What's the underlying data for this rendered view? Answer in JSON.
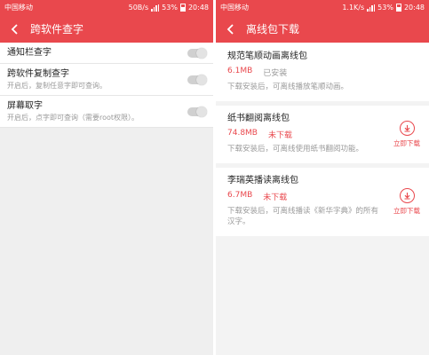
{
  "theme": {
    "accent": "#e9484d"
  },
  "left": {
    "status": {
      "carrier": "中国移动",
      "speed": "50B/s",
      "battery": "53%",
      "time": "20:48"
    },
    "title": "跨软件查字",
    "settings": [
      {
        "title": "通知栏查字",
        "subtitle": "",
        "enabled": false
      },
      {
        "title": "跨软件复制查字",
        "subtitle": "开启后，复制任意字即可查询。",
        "enabled": false
      },
      {
        "title": "屏幕取字",
        "subtitle": "开启后，点字即可查询（需要root权限）。",
        "enabled": false
      }
    ]
  },
  "right": {
    "status": {
      "carrier": "中国移动",
      "speed": "1.1K/s",
      "battery": "53%",
      "time": "20:48"
    },
    "title": "离线包下载",
    "packages": [
      {
        "title": "规范笔顺动画离线包",
        "size": "6.1MB",
        "status": "已安装",
        "description": "下载安装后，可离线播放笔顺动画。",
        "action": ""
      },
      {
        "title": "纸书翻阅离线包",
        "size": "74.8MB",
        "status": "未下载",
        "description": "下载安装后，可离线使用纸书翻阅功能。",
        "action": "立即下载"
      },
      {
        "title": "李瑞英播读离线包",
        "size": "6.7MB",
        "status": "未下载",
        "description": "下载安装后，可离线播读《新华字典》的所有汉字。",
        "action": "立即下载"
      }
    ]
  }
}
